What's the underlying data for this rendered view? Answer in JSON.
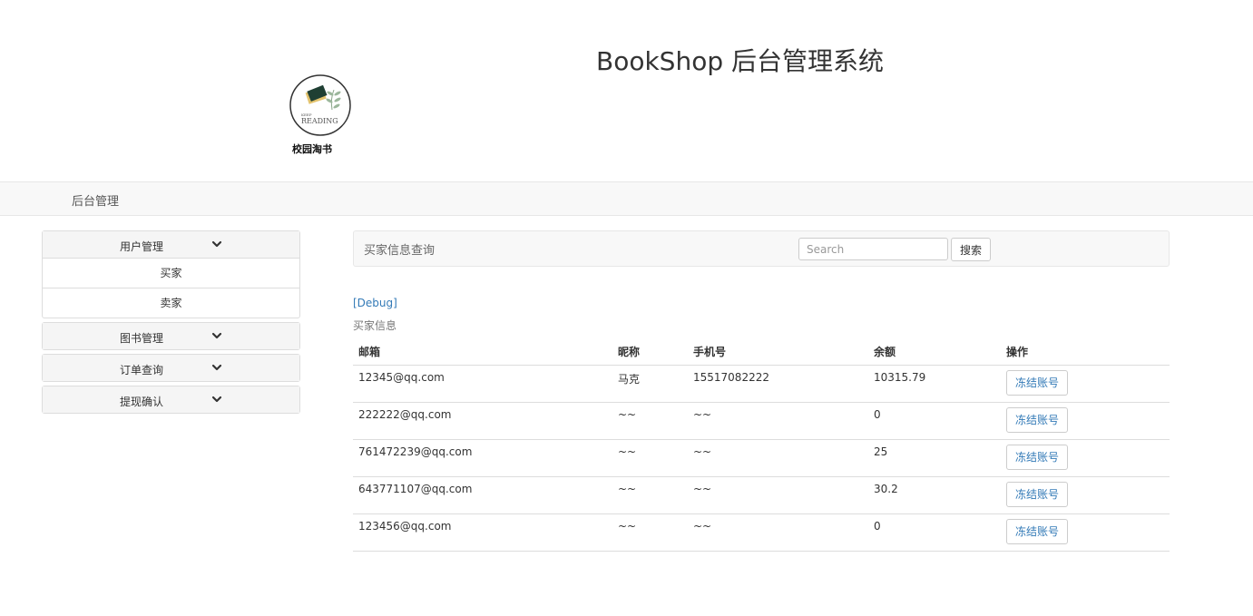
{
  "header": {
    "title": "BookShop 后台管理系统",
    "logo_caption": "校园淘书",
    "logo_text": "READING"
  },
  "navbar": {
    "brand": "后台管理"
  },
  "sidebar": {
    "groups": [
      {
        "label": "用户管理",
        "icon": "chevron-down-icon",
        "expanded": true,
        "items": [
          {
            "label": "买家"
          },
          {
            "label": "卖家"
          }
        ]
      },
      {
        "label": "图书管理",
        "icon": "chevron-down-icon",
        "expanded": false
      },
      {
        "label": "订单查询",
        "icon": "chevron-down-icon",
        "expanded": false
      },
      {
        "label": "提现确认",
        "icon": "chevron-down-icon",
        "expanded": false
      }
    ]
  },
  "search": {
    "title": "买家信息查询",
    "placeholder": "Search",
    "value": "",
    "button_label": "搜索"
  },
  "main": {
    "debug_link": "[Debug]",
    "caption": "买家信息",
    "table": {
      "columns": [
        "邮箱",
        "昵称",
        "手机号",
        "余额",
        "操作"
      ],
      "rows": [
        {
          "email": "12345@qq.com",
          "nickname": "马克",
          "phone": "15517082222",
          "balance": "10315.79",
          "action": "冻结账号"
        },
        {
          "email": "222222@qq.com",
          "nickname": "~~",
          "phone": "~~",
          "balance": "0",
          "action": "冻结账号"
        },
        {
          "email": "761472239@qq.com",
          "nickname": "~~",
          "phone": "~~",
          "balance": "25",
          "action": "冻结账号"
        },
        {
          "email": "643771107@qq.com",
          "nickname": "~~",
          "phone": "~~",
          "balance": "30.2",
          "action": "冻结账号"
        },
        {
          "email": "123456@qq.com",
          "nickname": "~~",
          "phone": "~~",
          "balance": "0",
          "action": "冻结账号"
        }
      ]
    }
  },
  "colors": {
    "link": "#337ab7",
    "navbar_bg": "#f8f8f8",
    "border": "#dddddd"
  }
}
